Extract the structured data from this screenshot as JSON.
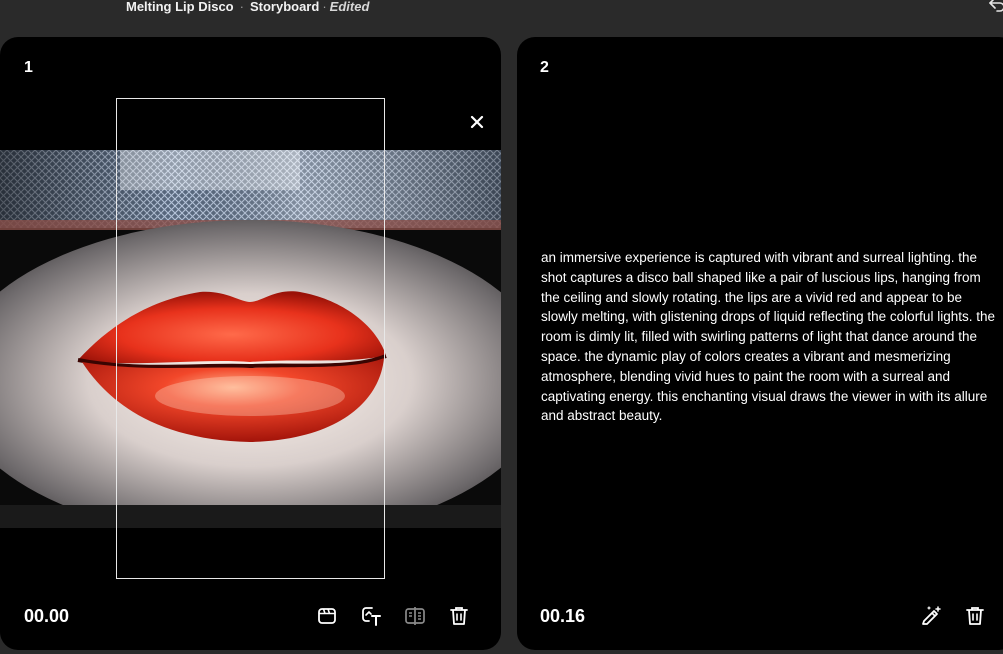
{
  "header": {
    "project_title": "Melting Lip Disco",
    "separator": "·",
    "section": "Storyboard",
    "status": "Edited",
    "undo_icon": "undo-icon"
  },
  "scenes": [
    {
      "number": "1",
      "timecode": "00.00",
      "image": "red-lips-disco-image",
      "tools": [
        "clapperboard-icon",
        "text-overlay-icon",
        "split-compare-icon",
        "trash-icon"
      ],
      "close_icon": "close-icon"
    },
    {
      "number": "2",
      "timecode": "00.16",
      "prompt": "an immersive experience is captured with vibrant and surreal lighting. the shot captures a disco ball shaped like a pair of luscious lips, hanging from the ceiling and slowly rotating. the lips are a vivid red and appear to be slowly melting, with glistening drops of liquid reflecting the colorful lights. the room is dimly lit, filled with swirling patterns of light that dance around the space. the dynamic play of colors creates a vibrant and mesmerizing atmosphere, blending vivid hues to paint the room with a surreal and captivating energy. this enchanting visual draws the viewer in with its allure and abstract beauty.",
      "tools": [
        "magic-wand-edit-icon",
        "trash-icon"
      ]
    }
  ],
  "colors": {
    "background": "#2a2a2a",
    "card": "#000000",
    "lips": "#e8321c",
    "text": "#ffffff"
  }
}
